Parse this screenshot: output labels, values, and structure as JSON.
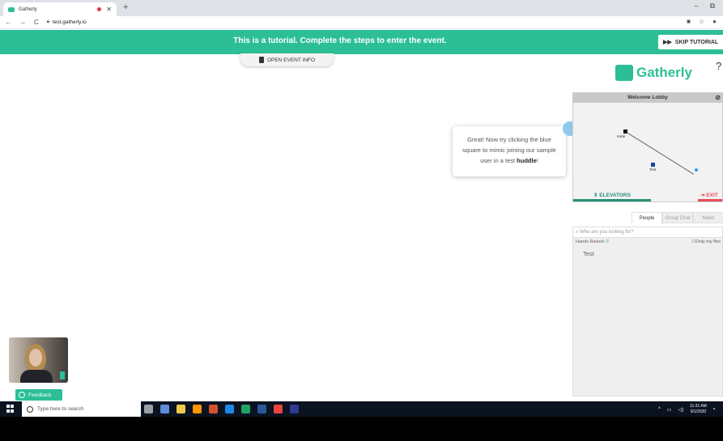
{
  "browser": {
    "tab_title": "Gatherly",
    "url": "test.gatherly.io"
  },
  "banner": {
    "message": "This is a tutorial. Complete the steps to enter the event.",
    "skip_label": "SKIP TUTORIAL"
  },
  "event_info_label": "OPEN EVENT INFO",
  "tooltip": {
    "text_before": "Great! Now try clicking the blue square to mimic joining our sample user in a test ",
    "bold": "huddle",
    "text_after": "!"
  },
  "brand": {
    "name": "Gatherly",
    "color": "#2cbf95"
  },
  "lobby": {
    "title": "Welcome Lobby",
    "user_a": "Katie",
    "user_b": "Test",
    "elevators_label": "ELEVATORS",
    "exit_label": "EXIT"
  },
  "people_tabs": [
    "People",
    "Group Chat",
    "News"
  ],
  "people": {
    "search_placeholder": "Who are you looking for?",
    "hands_raised_label": "Hands Raised:",
    "hands_raised_count": "0",
    "only_my_floor": "Only my floo",
    "users": [
      "Test"
    ]
  },
  "feedback_label": "Feedback",
  "taskbar": {
    "search_placeholder": "Type here to search",
    "time": "11:31 AM",
    "date": "9/1/2020"
  }
}
